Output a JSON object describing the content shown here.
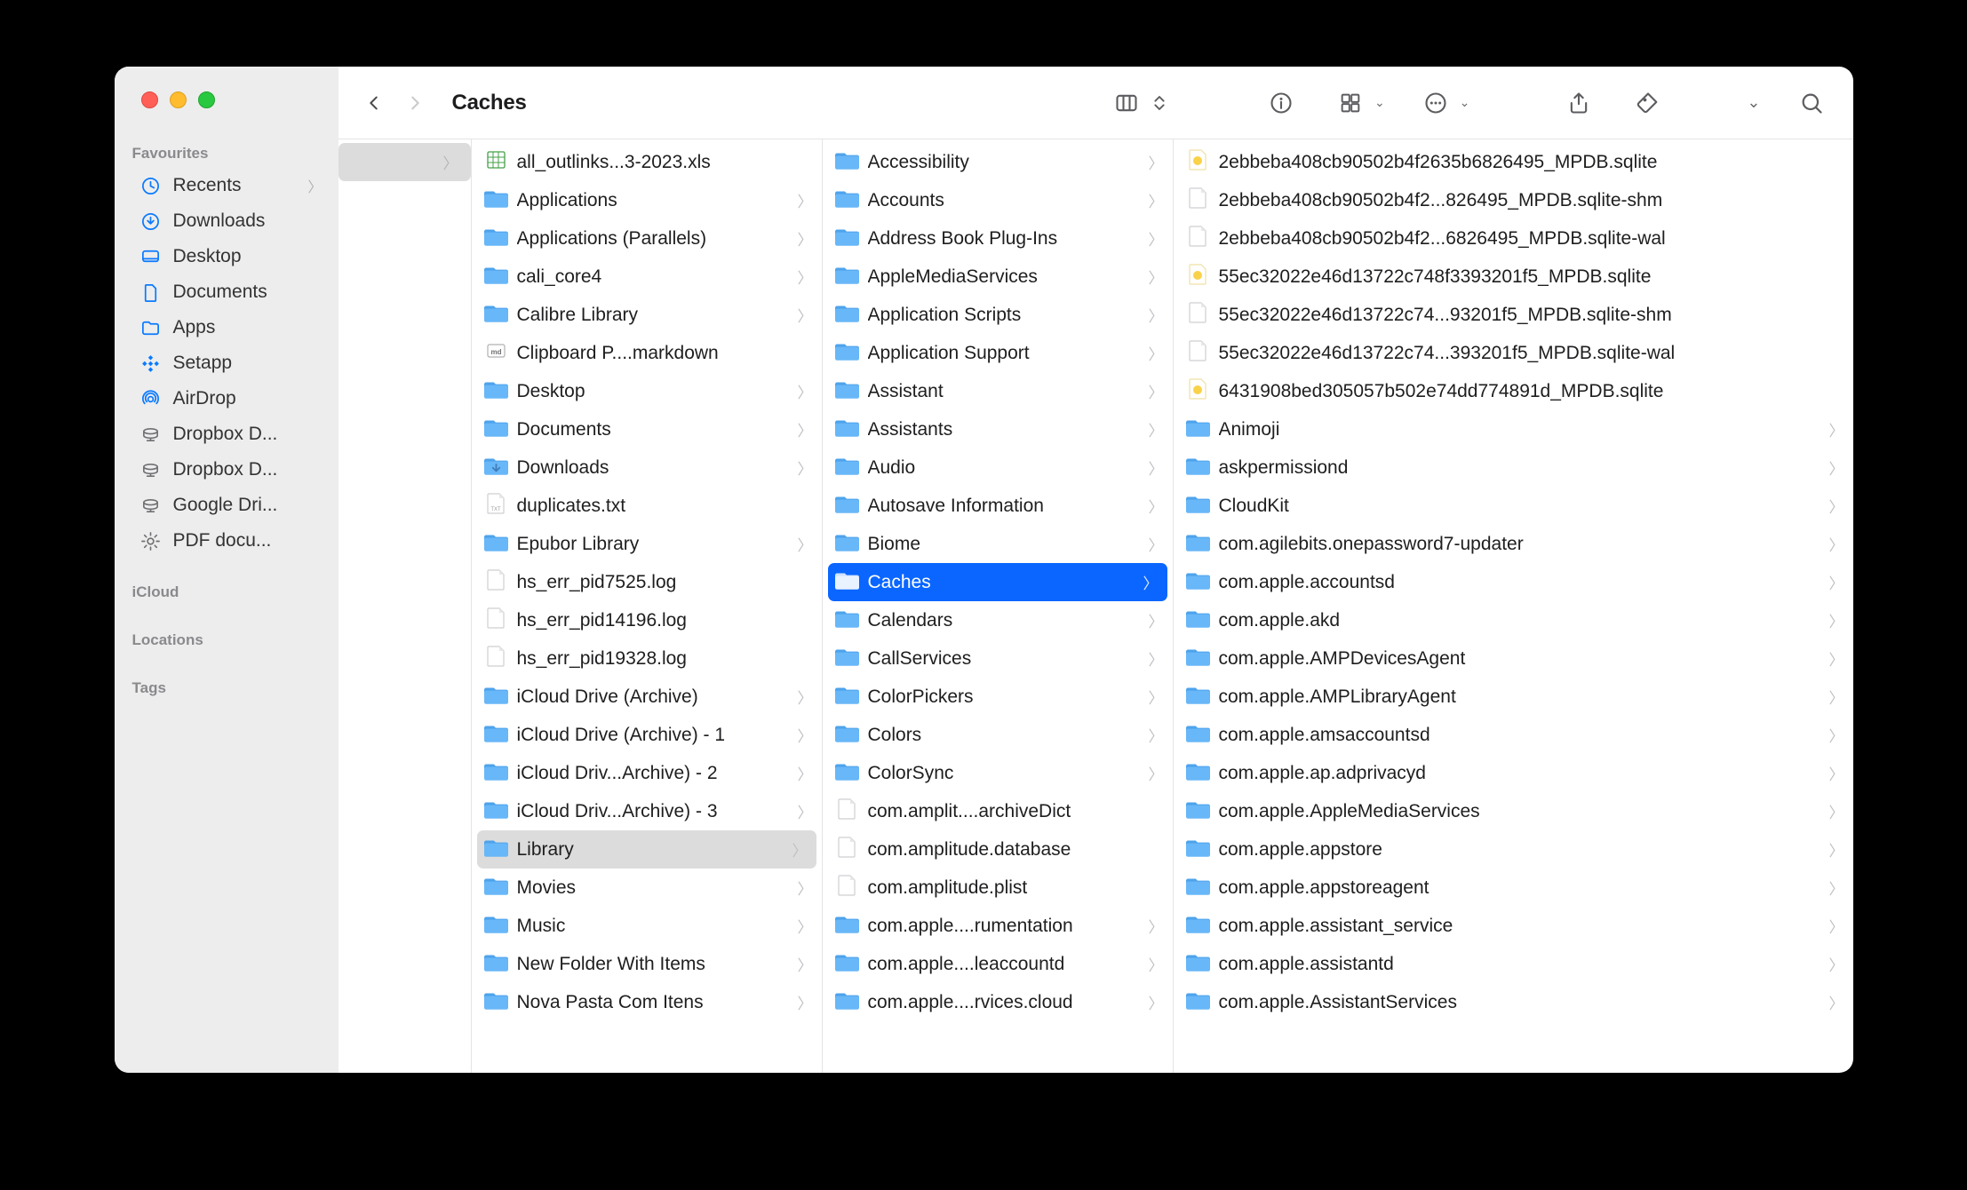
{
  "window": {
    "title": "Caches"
  },
  "sidebar": {
    "groups": [
      {
        "title": "Favourites",
        "items": [
          {
            "icon": "clock",
            "label": "Recents",
            "chev": true
          },
          {
            "icon": "download",
            "label": "Downloads"
          },
          {
            "icon": "desktop",
            "label": "Desktop"
          },
          {
            "icon": "doc",
            "label": "Documents"
          },
          {
            "icon": "folder",
            "label": "Apps"
          },
          {
            "icon": "setapp",
            "label": "Setapp"
          },
          {
            "icon": "airdrop",
            "label": "AirDrop"
          },
          {
            "icon": "drive",
            "label": "Dropbox D..."
          },
          {
            "icon": "drive",
            "label": "Dropbox D..."
          },
          {
            "icon": "drive",
            "label": "Google Dri..."
          },
          {
            "icon": "gear",
            "label": "PDF docu..."
          }
        ]
      },
      {
        "title": "iCloud",
        "items": []
      },
      {
        "title": "Locations",
        "items": []
      },
      {
        "title": "Tags",
        "items": []
      }
    ]
  },
  "columns": [
    {
      "items": [
        {
          "label": "",
          "kind": "folder",
          "arrow": true,
          "selected": "grey"
        }
      ]
    },
    {
      "items": [
        {
          "label": "all_outlinks...3-2023.xls",
          "kind": "xls"
        },
        {
          "label": "Applications",
          "kind": "folder",
          "arrow": true
        },
        {
          "label": "Applications (Parallels)",
          "kind": "folder",
          "arrow": true
        },
        {
          "label": "cali_core4",
          "kind": "folder",
          "arrow": true
        },
        {
          "label": "Calibre Library",
          "kind": "folder",
          "arrow": true
        },
        {
          "label": "Clipboard P....markdown",
          "kind": "md"
        },
        {
          "label": "Desktop",
          "kind": "folder",
          "arrow": true
        },
        {
          "label": "Documents",
          "kind": "folder",
          "arrow": true
        },
        {
          "label": "Downloads",
          "kind": "folder-dl",
          "arrow": true
        },
        {
          "label": "duplicates.txt",
          "kind": "txt"
        },
        {
          "label": "Epubor Library",
          "kind": "folder",
          "arrow": true
        },
        {
          "label": "hs_err_pid7525.log",
          "kind": "file"
        },
        {
          "label": "hs_err_pid14196.log",
          "kind": "file"
        },
        {
          "label": "hs_err_pid19328.log",
          "kind": "file"
        },
        {
          "label": "iCloud Drive (Archive)",
          "kind": "folder",
          "arrow": true
        },
        {
          "label": "iCloud Drive (Archive) - 1",
          "kind": "folder",
          "arrow": true
        },
        {
          "label": "iCloud Driv...Archive) - 2",
          "kind": "folder",
          "arrow": true
        },
        {
          "label": "iCloud Driv...Archive) - 3",
          "kind": "folder",
          "arrow": true
        },
        {
          "label": "Library",
          "kind": "folder",
          "arrow": true,
          "selected": "grey"
        },
        {
          "label": "Movies",
          "kind": "folder",
          "arrow": true
        },
        {
          "label": "Music",
          "kind": "folder",
          "arrow": true
        },
        {
          "label": "New Folder With Items",
          "kind": "folder",
          "arrow": true
        },
        {
          "label": "Nova Pasta Com Itens",
          "kind": "folder",
          "arrow": true
        }
      ]
    },
    {
      "items": [
        {
          "label": "Accessibility",
          "kind": "folder",
          "arrow": true
        },
        {
          "label": "Accounts",
          "kind": "folder",
          "arrow": true
        },
        {
          "label": "Address Book Plug-Ins",
          "kind": "folder",
          "arrow": true
        },
        {
          "label": "AppleMediaServices",
          "kind": "folder",
          "arrow": true
        },
        {
          "label": "Application Scripts",
          "kind": "folder",
          "arrow": true
        },
        {
          "label": "Application Support",
          "kind": "folder",
          "arrow": true
        },
        {
          "label": "Assistant",
          "kind": "folder",
          "arrow": true
        },
        {
          "label": "Assistants",
          "kind": "folder",
          "arrow": true
        },
        {
          "label": "Audio",
          "kind": "folder",
          "arrow": true
        },
        {
          "label": "Autosave Information",
          "kind": "folder",
          "arrow": true
        },
        {
          "label": "Biome",
          "kind": "folder",
          "arrow": true
        },
        {
          "label": "Caches",
          "kind": "folder",
          "arrow": true,
          "selected": "blue"
        },
        {
          "label": "Calendars",
          "kind": "folder",
          "arrow": true
        },
        {
          "label": "CallServices",
          "kind": "folder",
          "arrow": true
        },
        {
          "label": "ColorPickers",
          "kind": "folder",
          "arrow": true
        },
        {
          "label": "Colors",
          "kind": "folder",
          "arrow": true
        },
        {
          "label": "ColorSync",
          "kind": "folder",
          "arrow": true
        },
        {
          "label": "com.amplit....archiveDict",
          "kind": "file"
        },
        {
          "label": "com.amplitude.database",
          "kind": "file"
        },
        {
          "label": "com.amplitude.plist",
          "kind": "file"
        },
        {
          "label": "com.apple....rumentation",
          "kind": "folder",
          "arrow": true
        },
        {
          "label": "com.apple....leaccountd",
          "kind": "folder",
          "arrow": true
        },
        {
          "label": "com.apple....rvices.cloud",
          "kind": "folder",
          "arrow": true
        }
      ]
    },
    {
      "items": [
        {
          "label": "2ebbeba408cb90502b4f2635b6826495_MPDB.sqlite",
          "kind": "sqlite"
        },
        {
          "label": "2ebbeba408cb90502b4f2...826495_MPDB.sqlite-shm",
          "kind": "file"
        },
        {
          "label": "2ebbeba408cb90502b4f2...6826495_MPDB.sqlite-wal",
          "kind": "file"
        },
        {
          "label": "55ec32022e46d13722c748f3393201f5_MPDB.sqlite",
          "kind": "sqlite"
        },
        {
          "label": "55ec32022e46d13722c74...93201f5_MPDB.sqlite-shm",
          "kind": "file"
        },
        {
          "label": "55ec32022e46d13722c74...393201f5_MPDB.sqlite-wal",
          "kind": "file"
        },
        {
          "label": "6431908bed305057b502e74dd774891d_MPDB.sqlite",
          "kind": "sqlite"
        },
        {
          "label": "Animoji",
          "kind": "folder",
          "arrow": true
        },
        {
          "label": "askpermissiond",
          "kind": "folder",
          "arrow": true
        },
        {
          "label": "CloudKit",
          "kind": "folder",
          "arrow": true
        },
        {
          "label": "com.agilebits.onepassword7-updater",
          "kind": "folder",
          "arrow": true
        },
        {
          "label": "com.apple.accountsd",
          "kind": "folder",
          "arrow": true
        },
        {
          "label": "com.apple.akd",
          "kind": "folder",
          "arrow": true
        },
        {
          "label": "com.apple.AMPDevicesAgent",
          "kind": "folder",
          "arrow": true
        },
        {
          "label": "com.apple.AMPLibraryAgent",
          "kind": "folder",
          "arrow": true
        },
        {
          "label": "com.apple.amsaccountsd",
          "kind": "folder",
          "arrow": true
        },
        {
          "label": "com.apple.ap.adprivacyd",
          "kind": "folder",
          "arrow": true
        },
        {
          "label": "com.apple.AppleMediaServices",
          "kind": "folder",
          "arrow": true
        },
        {
          "label": "com.apple.appstore",
          "kind": "folder",
          "arrow": true
        },
        {
          "label": "com.apple.appstoreagent",
          "kind": "folder",
          "arrow": true
        },
        {
          "label": "com.apple.assistant_service",
          "kind": "folder",
          "arrow": true
        },
        {
          "label": "com.apple.assistantd",
          "kind": "folder",
          "arrow": true
        },
        {
          "label": "com.apple.AssistantServices",
          "kind": "folder",
          "arrow": true
        }
      ]
    }
  ]
}
